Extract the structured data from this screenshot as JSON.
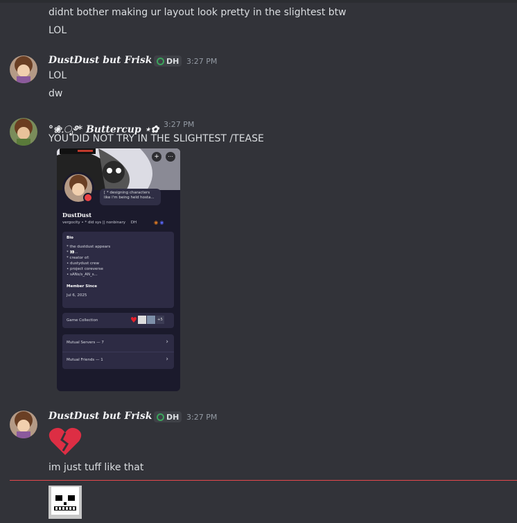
{
  "messages": {
    "m0": {
      "line1": "didnt bother making ur layout look pretty in the slightest btw",
      "line2": "LOL"
    },
    "m1": {
      "author": "DustDust but Frisk",
      "tag": "DH",
      "time": "3:27 PM",
      "line1": "LOL",
      "line2": "dw"
    },
    "m2": {
      "author": "°❀.ೃ࿔* Buttercup ⋆✿",
      "time": "3:27 PM",
      "line1": "YOU DID NOT TRY IN THE SLIGHTEST /TEASE"
    },
    "m3": {
      "author": "DustDust but Frisk",
      "tag": "DH",
      "time": "3:27 PM",
      "emoji": "broken-heart-emoji",
      "line1": "im just tuff like that"
    }
  },
  "embed": {
    "bubble": "[ * designing characters like i'm being held hosta...",
    "name": "DustDust",
    "sub": "vergocity  •  * did sys || nonbinary",
    "sub_tag": "DH",
    "bio_heading": "Bio",
    "bio_lines": [
      "* the dustdust appears",
      "* 👀...",
      "* creator of:",
      "• dustydust crew",
      "• project coreverse",
      "• sANs/s_AN_s..."
    ],
    "member_since_heading": "Member Since",
    "member_since": "Jul 6, 2025",
    "game_collection": "Game Collection",
    "game_more": "+5",
    "mutual_servers": "Mutual Servers — 7",
    "mutual_friends": "Mutual Friends — 1"
  },
  "colors": {
    "background": "#323339",
    "unread_divider": "#e5484d",
    "embed_bg": "#1b1a2c"
  }
}
